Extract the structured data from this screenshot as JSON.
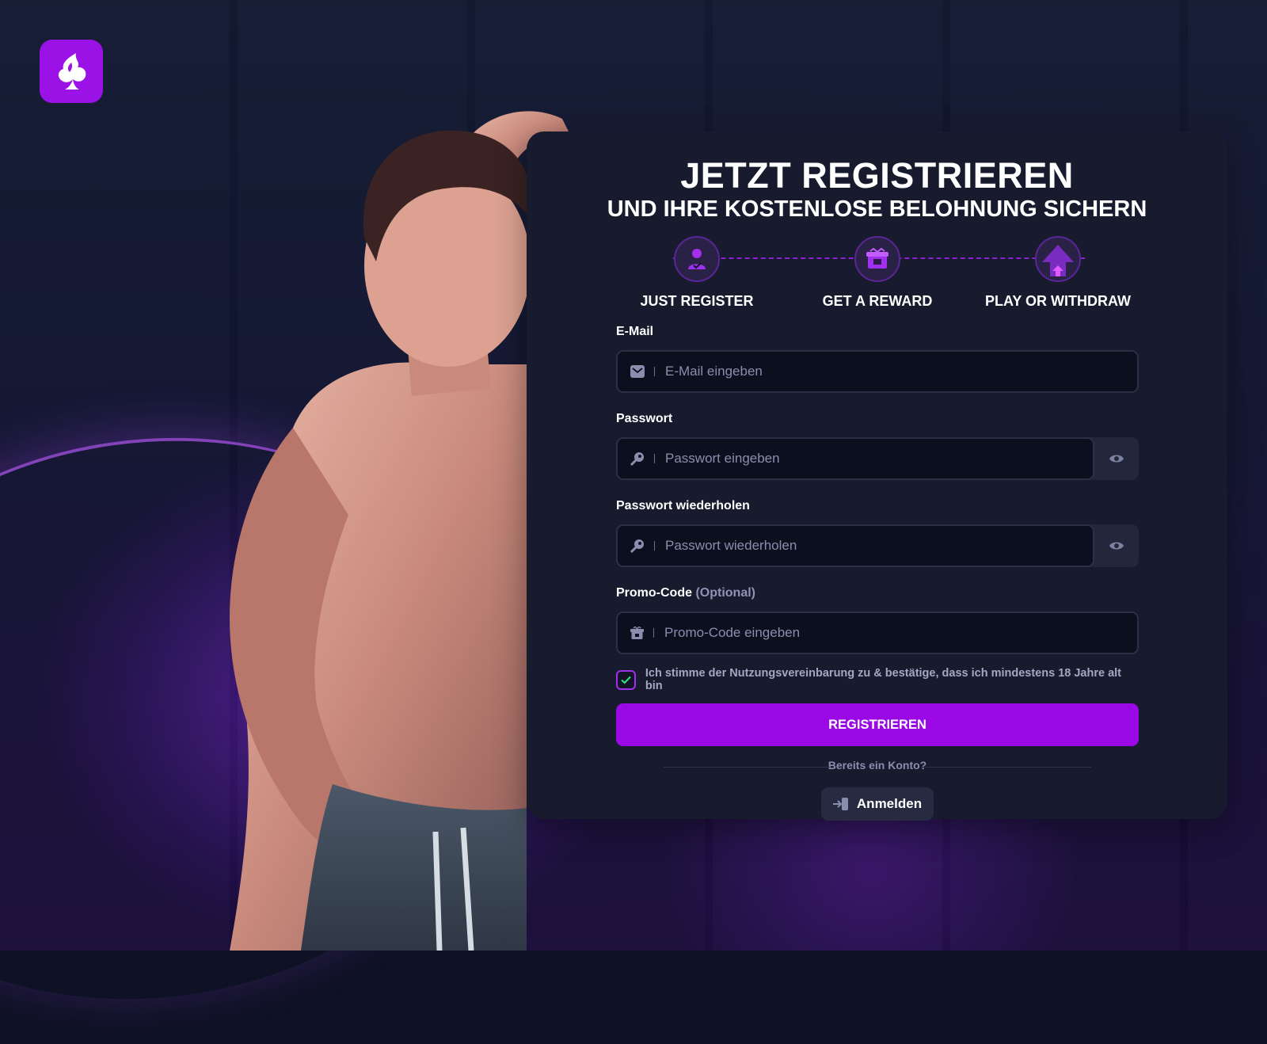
{
  "brand": {
    "logo_icon": "spade-flame-logo-icon",
    "accent": "#9a08e6"
  },
  "hero": {
    "title": "JETZT REGISTRIEREN",
    "subtitle": "UND IHRE KOSTENLOSE BELOHNUNG SICHERN"
  },
  "steps": [
    {
      "label": "JUST REGISTER",
      "icon": "user-check-icon"
    },
    {
      "label": "GET A REWARD",
      "icon": "gift-box-icon"
    },
    {
      "label": "PLAY OR WITHDRAW",
      "icon": "arrow-up-icon"
    }
  ],
  "form": {
    "email": {
      "label": "E-Mail",
      "placeholder": "E-Mail eingeben",
      "icon": "envelope-icon"
    },
    "password": {
      "label": "Passwort",
      "placeholder": "Passwort eingeben",
      "icon": "key-icon",
      "toggle_icon": "eye-icon"
    },
    "password_repeat": {
      "label": "Passwort wiederholen",
      "placeholder": "Passwort wiederholen",
      "icon": "key-icon",
      "toggle_icon": "eye-icon"
    },
    "promo": {
      "label": "Promo-Code",
      "optional": "(Optional)",
      "placeholder": "Promo-Code eingeben",
      "icon": "gift-icon"
    },
    "consent": {
      "text": "Ich stimme der Nutzungsvereinbarung zu & bestätige, dass ich mindestens 18 Jahre alt bin",
      "checked": true
    },
    "submit_label": "REGISTRIEREN"
  },
  "login": {
    "prompt": "Bereits ein Konto?",
    "button_label": "Anmelden",
    "icon": "sign-in-icon"
  }
}
